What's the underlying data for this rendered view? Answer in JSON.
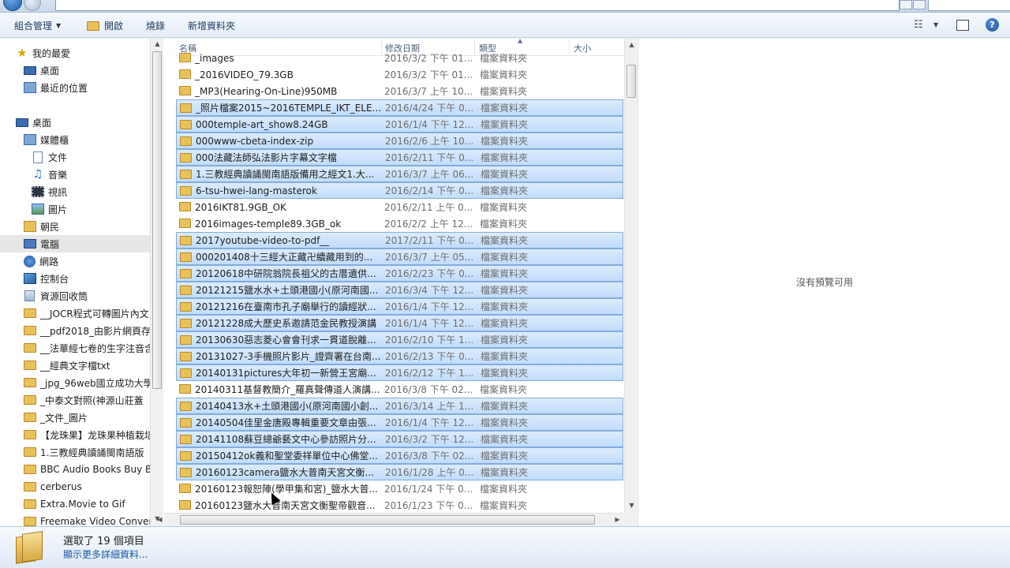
{
  "toolbar": {
    "organize": "組合管理",
    "open": "開啟",
    "burn": "燒錄",
    "new_folder": "新增資料夾"
  },
  "nav": {
    "favorites": "我的最愛",
    "fav_desktop": "桌面",
    "recent": "最近的位置",
    "desktop": "桌面",
    "libraries": "媒體櫃",
    "documents": "文件",
    "music": "音樂",
    "videos": "視訊",
    "pictures": "圖片",
    "user": "朝民",
    "computer": "電腦",
    "network": "網路",
    "control_panel": "控制台",
    "recycle_bin": "資源回收筒",
    "folders": [
      "__JOCR程式可轉圖片內文",
      "__pdf2018_由影片網頁存",
      "__法華經七卷的生字注音含",
      "__經典文字檔txt",
      "_jpg_96web國立成功大學",
      "_中泰文對照(神源山莊蓋",
      "_文件_圖片",
      "【龙珠果】龙珠果种植栽培",
      "1.三教經典讀誦閩南語版",
      "BBC Audio Books   Buy BB",
      "cerberus",
      "Extra.Movie to Gif",
      "Freemake Video Converter"
    ]
  },
  "columns": {
    "name": "名稱",
    "date": "修改日期",
    "type": "類型",
    "size": "大小"
  },
  "files": [
    {
      "name": "_images",
      "date": "2016/3/2 下午 01...",
      "type": "檔案資料夾",
      "selected": false
    },
    {
      "name": "_2016VIDEO_79.3GB",
      "date": "2016/3/2 下午 01...",
      "type": "檔案資料夾",
      "selected": false
    },
    {
      "name": "_MP3(Hearing-On-Line)950MB",
      "date": "2016/3/7 上午 10...",
      "type": "檔案資料夾",
      "selected": false
    },
    {
      "name": "_照片檔案2015~2016TEMPLE_IKT_ELE...",
      "date": "2016/4/24 下午 0...",
      "type": "檔案資料夾",
      "selected": true
    },
    {
      "name": "000temple-art_show8.24GB",
      "date": "2016/1/4 下午 12...",
      "type": "檔案資料夾",
      "selected": true
    },
    {
      "name": "000www-cbeta-index-zip",
      "date": "2016/2/6 上午 10...",
      "type": "檔案資料夾",
      "selected": true
    },
    {
      "name": "000法藏法師弘法影片字幕文字檔",
      "date": "2016/2/11 下午 0...",
      "type": "檔案資料夾",
      "selected": true
    },
    {
      "name": "1.三教經典讀誦閩南語版備用之經文1.大...",
      "date": "2016/3/7 上午 06...",
      "type": "檔案資料夾",
      "selected": true
    },
    {
      "name": "6-tsu-hwei-lang-masterok",
      "date": "2016/2/14 下午 0...",
      "type": "檔案資料夾",
      "selected": true
    },
    {
      "name": "2016IKT81.9GB_OK",
      "date": "2016/2/11 上午 0...",
      "type": "檔案資料夾",
      "selected": false
    },
    {
      "name": "2016images-temple89.3GB_ok",
      "date": "2016/2/2 上午 12...",
      "type": "檔案資料夾",
      "selected": false
    },
    {
      "name": "2017youtube-video-to-pdf__",
      "date": "2017/2/11 下午 0...",
      "type": "檔案資料夾",
      "selected": true
    },
    {
      "name": "000201408十三經大正藏卍續藏用到的...",
      "date": "2016/3/7 上午 05...",
      "type": "檔案資料夾",
      "selected": true
    },
    {
      "name": "20120618中研院翁院長祖父的古厝遺供...",
      "date": "2016/2/23 下午 0...",
      "type": "檔案資料夾",
      "selected": true
    },
    {
      "name": "20121215鹽水水+土頭港國小(原河南國...",
      "date": "2016/3/4 下午 12...",
      "type": "檔案資料夾",
      "selected": true
    },
    {
      "name": "20121216在臺南市孔子廟舉行的讀經狀...",
      "date": "2016/1/4 下午 12...",
      "type": "檔案資料夾",
      "selected": true
    },
    {
      "name": "20121228成大歷史系邀請范金民教授演講",
      "date": "2016/1/4 下午 12...",
      "type": "檔案資料夾",
      "selected": true
    },
    {
      "name": "20130630惡志菱心會會刊求一貫道脫離...",
      "date": "2016/2/10 下午 1...",
      "type": "檔案資料夾",
      "selected": true
    },
    {
      "name": "20131027-3手機照片影片_證齊署在台南...",
      "date": "2016/2/13 下午 0...",
      "type": "檔案資料夾",
      "selected": true
    },
    {
      "name": "20140131pictures大年初一新營王宮廟...",
      "date": "2016/2/12 下午 1...",
      "type": "檔案資料夾",
      "selected": true
    },
    {
      "name": "20140311基督教簡介_羅真聲傳道人演講...",
      "date": "2016/3/8 下午 02...",
      "type": "檔案資料夾",
      "selected": false
    },
    {
      "name": "20140413水+土頭港國小(原河南國小創...",
      "date": "2016/3/14 上午 1...",
      "type": "檔案資料夾",
      "selected": true
    },
    {
      "name": "20140504佳里金唐殿專輯重要文章由張...",
      "date": "2016/1/4 下午 12...",
      "type": "檔案資料夾",
      "selected": true
    },
    {
      "name": "20141108蘇豆總爺藝文中心參訪照片分...",
      "date": "2016/3/2 下午 12...",
      "type": "檔案資料夾",
      "selected": true
    },
    {
      "name": "20150412ok義和聖堂委祥單位中心佛堂...",
      "date": "2016/3/8 下午 02...",
      "type": "檔案資料夾",
      "selected": true
    },
    {
      "name": "20160123camera鹽水大普南天宮文衡...",
      "date": "2016/1/28 上午 0...",
      "type": "檔案資料夾",
      "selected": true
    },
    {
      "name": "20160123報恕陣(學甲集和宮)_鹽水大普...",
      "date": "2016/1/24 下午 0...",
      "type": "檔案資料夾",
      "selected": false
    },
    {
      "name": "20160123鹽水大普南天宮文衡聖帝觀音...",
      "date": "2016/1/23 下午 0...",
      "type": "檔案資料夾",
      "selected": false
    }
  ],
  "preview": {
    "empty_text": "沒有預覽可用"
  },
  "details": {
    "selected_count": "選取了 19 個項目",
    "more_details": "顯示更多詳細資料..."
  }
}
